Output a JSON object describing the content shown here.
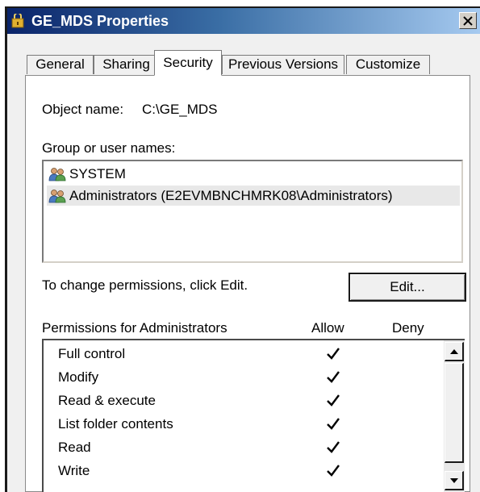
{
  "window": {
    "title": "GE_MDS Properties",
    "close_label": "X"
  },
  "tabs": [
    {
      "label": "General",
      "active": false
    },
    {
      "label": "Sharing",
      "active": false
    },
    {
      "label": "Security",
      "active": true
    },
    {
      "label": "Previous Versions",
      "active": false
    },
    {
      "label": "Customize",
      "active": false
    }
  ],
  "security": {
    "object_name_label": "Object name:",
    "object_name_value": "C:\\GE_MDS",
    "group_label": "Group or user names:",
    "users": [
      {
        "name": "SYSTEM",
        "icon": "users-icon",
        "selected": false
      },
      {
        "name": "Administrators (E2EVMBNCHMRK08\\Administrators)",
        "icon": "users-icon",
        "selected": true
      }
    ],
    "change_hint": "To change permissions, click Edit.",
    "edit_label": "Edit...",
    "permissions_header": "Permissions for Administrators",
    "allow_header": "Allow",
    "deny_header": "Deny",
    "permissions": [
      {
        "name": "Full control",
        "allow": true,
        "deny": false
      },
      {
        "name": "Modify",
        "allow": true,
        "deny": false
      },
      {
        "name": "Read & execute",
        "allow": true,
        "deny": false
      },
      {
        "name": "List folder contents",
        "allow": true,
        "deny": false
      },
      {
        "name": "Read",
        "allow": true,
        "deny": false
      },
      {
        "name": "Write",
        "allow": true,
        "deny": false
      }
    ]
  },
  "colors": {
    "title_bar_start": "#0a246a",
    "title_bar_end": "#a6caf0",
    "panel_background": "#ffffff",
    "window_background": "#f0f0f0"
  }
}
